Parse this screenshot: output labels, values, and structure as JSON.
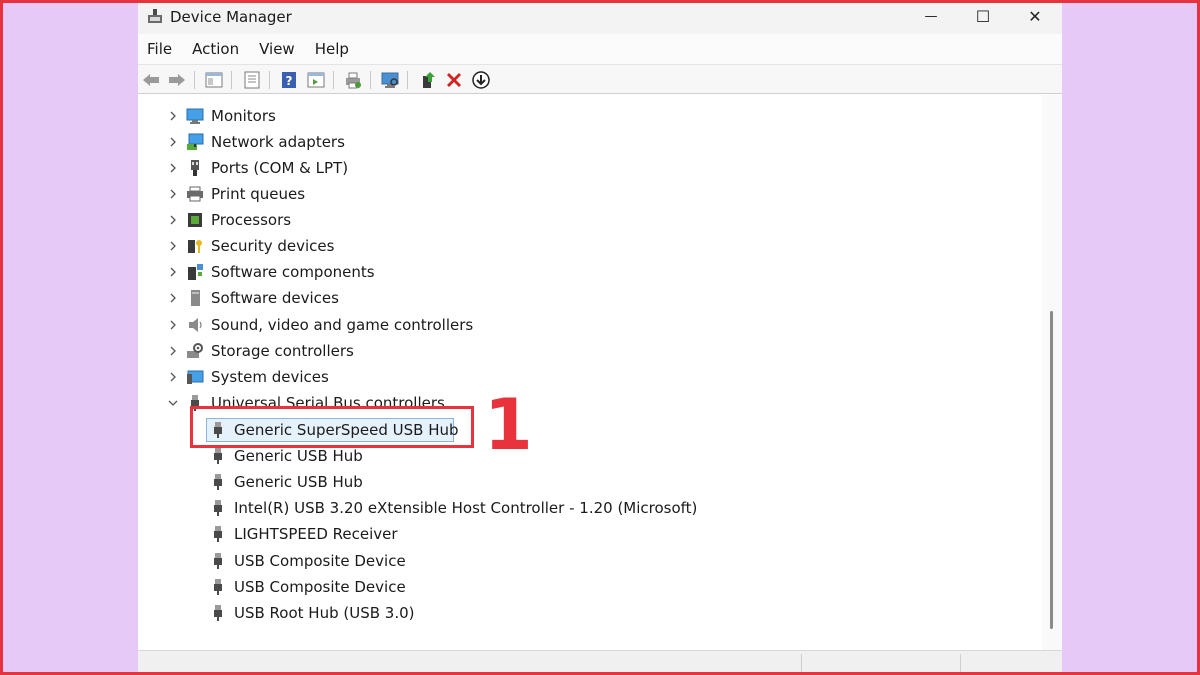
{
  "window": {
    "title": "Device Manager",
    "minimize_glyph": "—",
    "maximize_glyph": "☐",
    "close_glyph": "✕"
  },
  "menu": [
    "File",
    "Action",
    "View",
    "Help"
  ],
  "toolbar": {
    "icons": [
      "back-arrow-icon",
      "forward-arrow-icon",
      "show-hide-tree-icon",
      "properties-icon",
      "help-icon",
      "view-icon",
      "print-icon",
      "scan-hardware-icon",
      "update-driver-icon",
      "uninstall-icon",
      "download-icon"
    ]
  },
  "tree": {
    "categories": [
      {
        "label": "Monitors",
        "icon": "monitor-icon"
      },
      {
        "label": "Network adapters",
        "icon": "network-adapter-icon"
      },
      {
        "label": "Ports (COM & LPT)",
        "icon": "port-icon"
      },
      {
        "label": "Print queues",
        "icon": "printer-icon"
      },
      {
        "label": "Processors",
        "icon": "processor-icon"
      },
      {
        "label": "Security devices",
        "icon": "security-device-icon"
      },
      {
        "label": "Software components",
        "icon": "software-component-icon"
      },
      {
        "label": "Software devices",
        "icon": "software-device-icon"
      },
      {
        "label": "Sound, video and game controllers",
        "icon": "speaker-icon"
      },
      {
        "label": "Storage controllers",
        "icon": "storage-controller-icon"
      },
      {
        "label": "System devices",
        "icon": "system-device-icon"
      },
      {
        "label": "Universal Serial Bus controllers",
        "icon": "usb-icon"
      }
    ],
    "usb_children": [
      "Generic SuperSpeed USB Hub",
      "Generic USB Hub",
      "Generic USB Hub",
      "Intel(R) USB 3.20 eXtensible Host Controller - 1.20 (Microsoft)",
      "LIGHTSPEED Receiver",
      "USB Composite Device",
      "USB Composite Device",
      "USB Root Hub (USB 3.0)"
    ],
    "selected_index": 0
  },
  "annotation": {
    "number": "1"
  },
  "colors": {
    "annotation": "#e8323c",
    "selection": "#e5f1fb",
    "background": "#e6c9f7"
  }
}
